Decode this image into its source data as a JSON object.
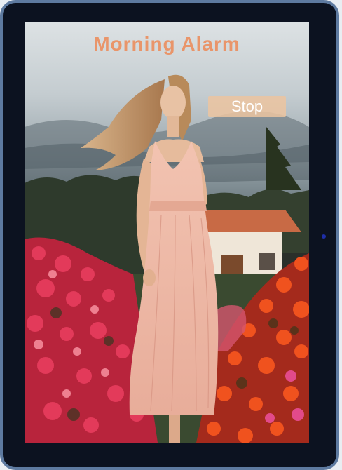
{
  "alarm": {
    "title": "Morning Alarm",
    "stop_label": "Stop"
  },
  "colors": {
    "accent": "#e9956a",
    "button_bg": "#ecc4a0",
    "frame": "#5e7aa0",
    "bezel": "#0c1220"
  },
  "background_image": "woman-in-pink-dress-in-flower-field"
}
